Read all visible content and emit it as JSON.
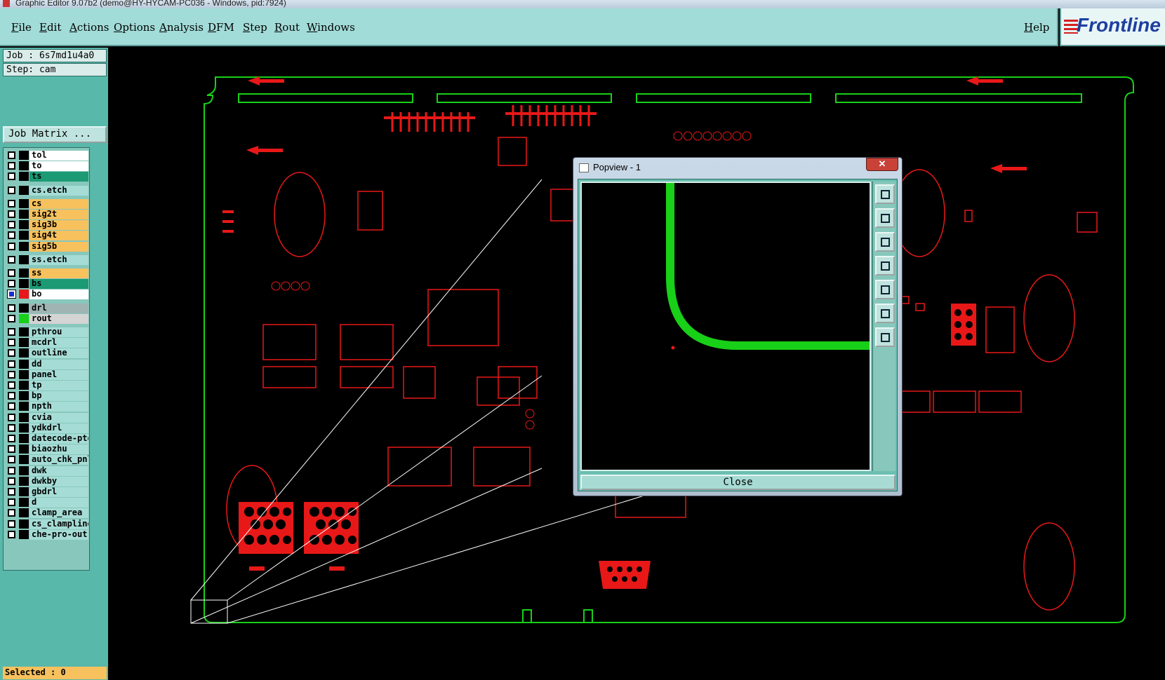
{
  "window": {
    "title": "Graphic Editor 9.07b2 (demo@HY-HYCAM-PC036 - Windows, pid:7924)"
  },
  "menu": {
    "items": [
      "File",
      "Edit",
      "Actions",
      "Options",
      "Analysis",
      "DFM",
      "Step",
      "Rout",
      "Windows"
    ],
    "help": "Help"
  },
  "logo": {
    "text": "Frontline"
  },
  "job": {
    "job_label": "Job : 6s7md1u4a0",
    "step_label": "Step: cam",
    "matrix_button": "Job Matrix ..."
  },
  "layers": [
    {
      "name": "tol",
      "color": "#ffffff",
      "swatch": "#000000",
      "checked": false
    },
    {
      "name": "to",
      "color": "#ffffff",
      "swatch": "#000000",
      "checked": false
    },
    {
      "name": "ts",
      "color": "#1c9a74",
      "swatch": "#000000",
      "checked": false
    },
    {
      "name": "cs.etch",
      "color": "#a6dcd6",
      "swatch": "#000000",
      "checked": false
    },
    {
      "name": "cs",
      "color": "#f7c15e",
      "swatch": "#000000",
      "checked": false
    },
    {
      "name": "sig2t",
      "color": "#f7c15e",
      "swatch": "#000000",
      "checked": false
    },
    {
      "name": "sig3b",
      "color": "#f7c15e",
      "swatch": "#000000",
      "checked": false
    },
    {
      "name": "sig4t",
      "color": "#f7c15e",
      "swatch": "#000000",
      "checked": false
    },
    {
      "name": "sig5b",
      "color": "#f7c15e",
      "swatch": "#000000",
      "checked": false
    },
    {
      "name": "ss.etch",
      "color": "#a6dcd6",
      "swatch": "#000000",
      "checked": false
    },
    {
      "name": "ss",
      "color": "#f7c15e",
      "swatch": "#000000",
      "checked": false
    },
    {
      "name": "bs",
      "color": "#1c9a74",
      "swatch": "#000000",
      "checked": false
    },
    {
      "name": "bo",
      "color": "#ffffff",
      "swatch": "#e81818",
      "checked": true
    },
    {
      "name": "drl",
      "color": "#a0b4b4",
      "swatch": "#000000",
      "checked": false
    },
    {
      "name": "rout",
      "color": "#d4d4d4",
      "swatch": "#18d018",
      "checked": false
    },
    {
      "name": "pthrou",
      "color": "#a6dcd6",
      "swatch": "#000000",
      "checked": false
    },
    {
      "name": "mcdrl",
      "color": "#a6dcd6",
      "swatch": "#000000",
      "checked": false
    },
    {
      "name": "outline",
      "color": "#a6dcd6",
      "swatch": "#000000",
      "checked": false
    },
    {
      "name": "dd",
      "color": "#a6dcd6",
      "swatch": "#000000",
      "checked": false
    },
    {
      "name": "panel",
      "color": "#a6dcd6",
      "swatch": "#000000",
      "checked": false
    },
    {
      "name": "tp",
      "color": "#a6dcd6",
      "swatch": "#000000",
      "checked": false
    },
    {
      "name": "bp",
      "color": "#a6dcd6",
      "swatch": "#000000",
      "checked": false
    },
    {
      "name": "npth",
      "color": "#a6dcd6",
      "swatch": "#000000",
      "checked": false
    },
    {
      "name": "cvia",
      "color": "#a6dcd6",
      "swatch": "#000000",
      "checked": false
    },
    {
      "name": "ydkdrl",
      "color": "#a6dcd6",
      "swatch": "#000000",
      "checked": false
    },
    {
      "name": "datecode-pto",
      "color": "#a6dcd6",
      "swatch": "#000000",
      "checked": false
    },
    {
      "name": "biaozhu",
      "color": "#a6dcd6",
      "swatch": "#000000",
      "checked": false
    },
    {
      "name": "auto_chk_pnl",
      "color": "#a6dcd6",
      "swatch": "#000000",
      "checked": false
    },
    {
      "name": "dwk",
      "color": "#a6dcd6",
      "swatch": "#000000",
      "checked": false
    },
    {
      "name": "dwkby",
      "color": "#a6dcd6",
      "swatch": "#000000",
      "checked": false
    },
    {
      "name": "gbdrl",
      "color": "#a6dcd6",
      "swatch": "#000000",
      "checked": false
    },
    {
      "name": "d",
      "color": "#a6dcd6",
      "swatch": "#000000",
      "checked": false
    },
    {
      "name": "clamp_area",
      "color": "#a6dcd6",
      "swatch": "#000000",
      "checked": false
    },
    {
      "name": "cs_clampline",
      "color": "#a6dcd6",
      "swatch": "#000000",
      "checked": false
    },
    {
      "name": "che-pro-out",
      "color": "#a6dcd6",
      "swatch": "#000000",
      "checked": false
    }
  ],
  "status": {
    "selected": "Selected : 0"
  },
  "popview": {
    "title": "Popview - 1",
    "close_x": "✕",
    "close_button": "Close"
  },
  "colors": {
    "board_outline": "#18d018",
    "component_layer": "#e81818",
    "panel_teal": "#58b8aa",
    "menu_bg": "#a2dcd8"
  }
}
